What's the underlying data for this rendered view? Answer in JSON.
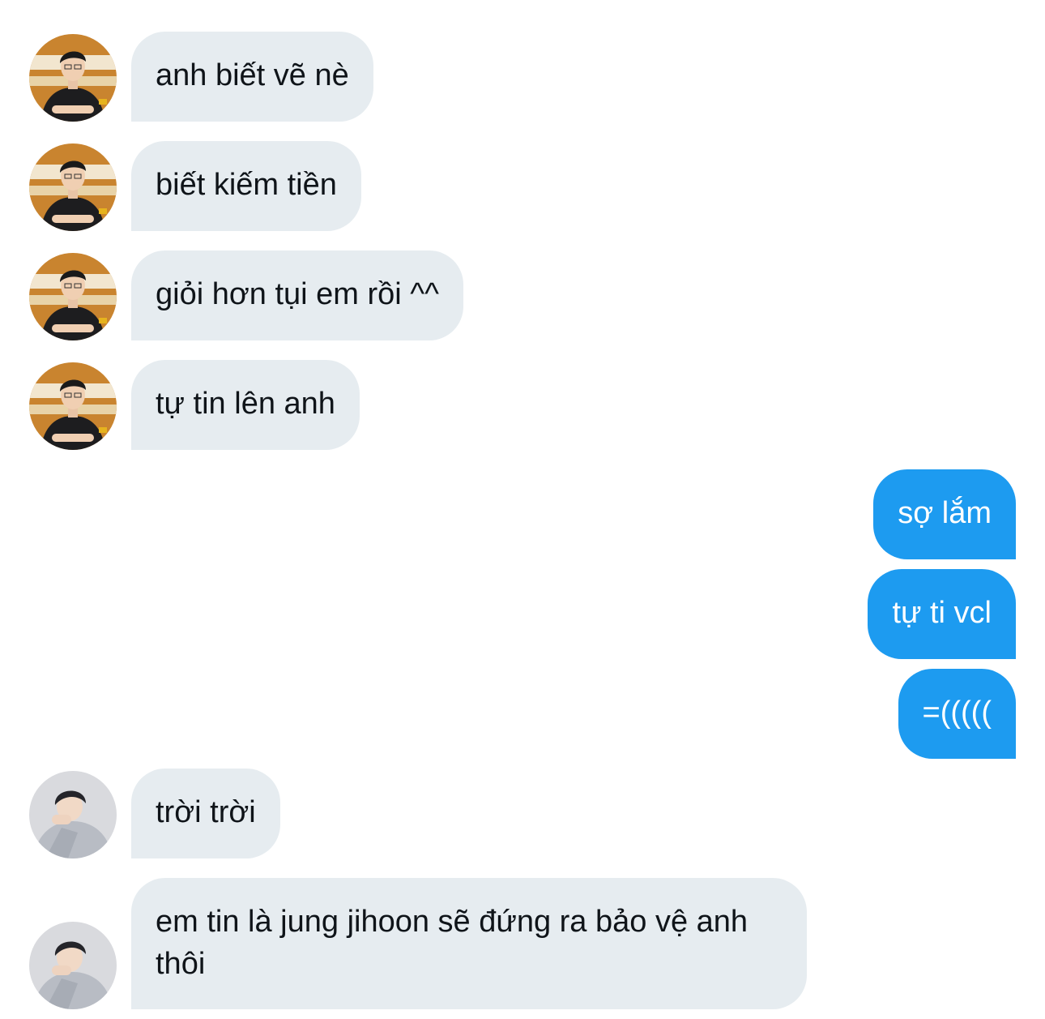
{
  "conversation": {
    "messages": [
      {
        "sender": "them",
        "text": "anh biết vẽ nè"
      },
      {
        "sender": "them",
        "text": "biết kiếm tiền"
      },
      {
        "sender": "them",
        "text": "giỏi hơn tụi em rồi ^^"
      },
      {
        "sender": "them",
        "text": "tự tin lên anh"
      },
      {
        "sender": "me",
        "text": "sợ lắm"
      },
      {
        "sender": "me",
        "text": "tự ti vcl"
      },
      {
        "sender": "me",
        "text": "=((((("
      },
      {
        "sender": "them2",
        "text": "trời trời"
      },
      {
        "sender": "them2",
        "text": "em tin là jung jihoon sẽ đứng ra bảo vệ anh thôi"
      }
    ]
  },
  "colors": {
    "incoming_bubble": "#e6ecf0",
    "outgoing_bubble": "#1d9bf0",
    "text_dark": "#0f1419",
    "text_light": "#ffffff"
  }
}
